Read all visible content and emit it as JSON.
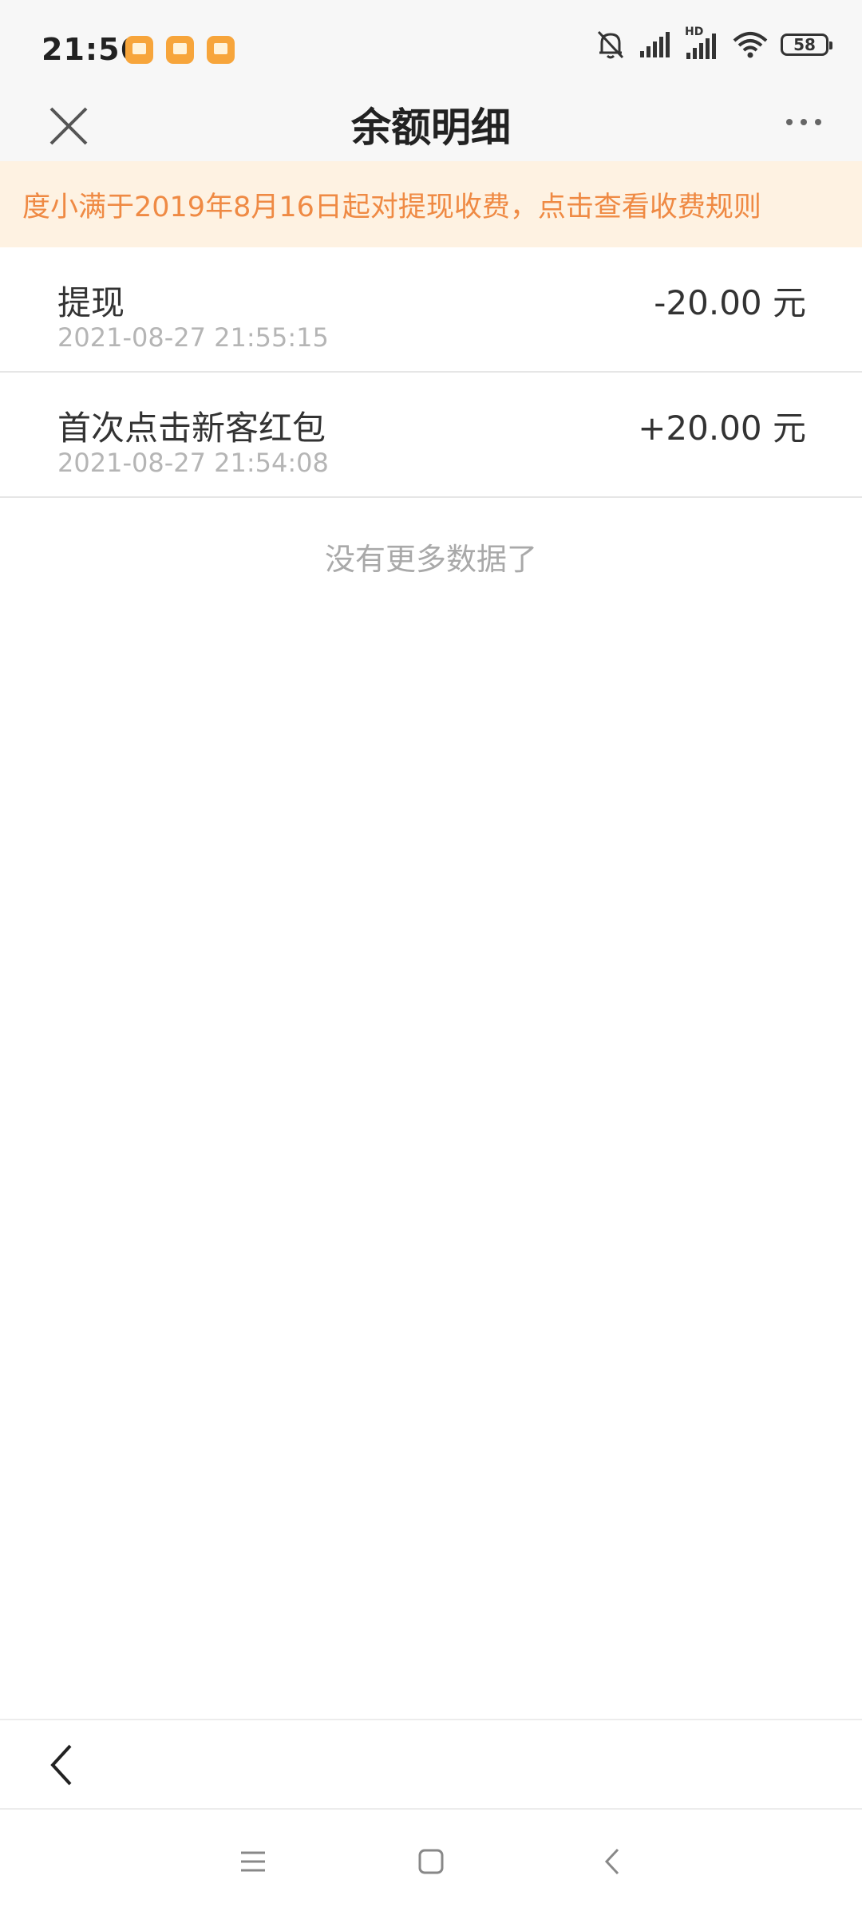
{
  "status_bar": {
    "time": "21:56",
    "battery": "58",
    "network_label": "HD"
  },
  "nav": {
    "title": "余额明细"
  },
  "banner": {
    "text": "度小满于2019年8月16日起对提现收费，点击查看收费规则"
  },
  "transactions": [
    {
      "title": "提现",
      "time": "2021-08-27 21:55:15",
      "amount": "-20.00 元"
    },
    {
      "title": "首次点击新客红包",
      "time": "2021-08-27 21:54:08",
      "amount": "+20.00 元"
    }
  ],
  "list_footer": "没有更多数据了",
  "colors": {
    "banner_bg": "#fef2e2",
    "banner_text": "#ef8a44",
    "notif_icon": "#f7a53b"
  }
}
